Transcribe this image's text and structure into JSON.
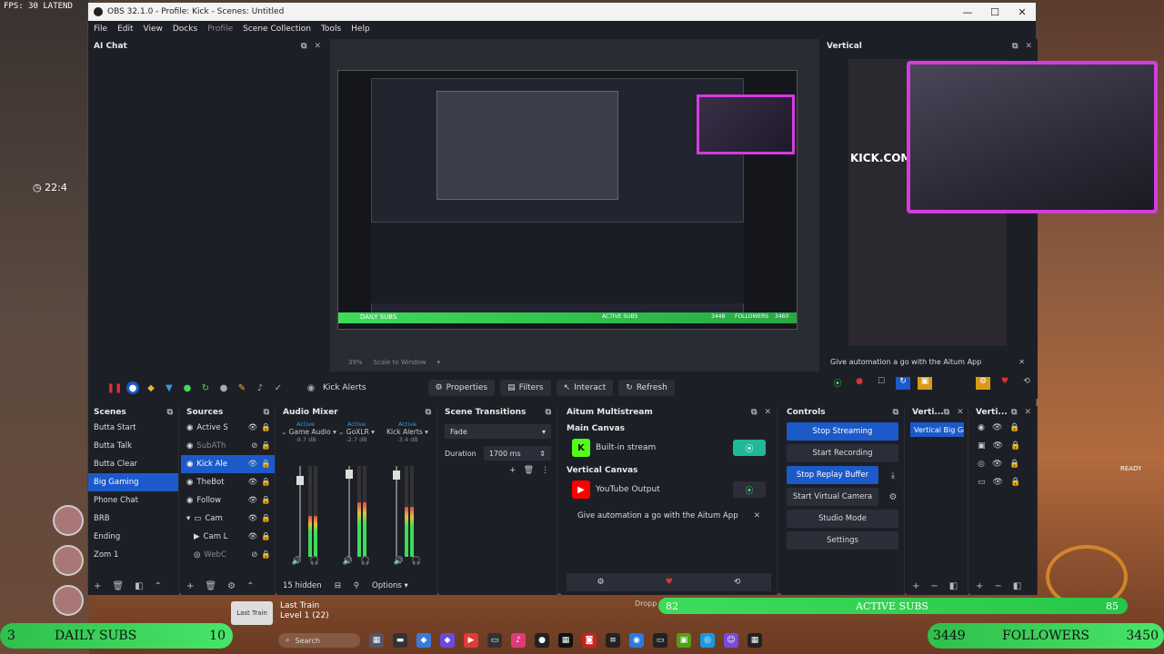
{
  "hud": {
    "fps_label": "FPS:",
    "fps_value": "30",
    "latency_label": "LATEND",
    "clock": "22:4"
  },
  "window": {
    "title": "OBS 32.1.0 - Profile: Kick - Scenes: Untitled",
    "min": "—",
    "max": "☐",
    "close": "✕"
  },
  "menu": [
    "File",
    "Edit",
    "View",
    "Docks",
    "Profile",
    "Scene Collection",
    "Tools",
    "Help"
  ],
  "ai_chat": {
    "title": "AI Chat"
  },
  "preview": {
    "zoom": "39%",
    "scale_mode": "Scale to Window",
    "daily_subs": "DAILY SUBS",
    "followers_small": "FOLLOWERS",
    "followers_left": "3448",
    "followers_right": "3460",
    "active_subs_small": "ACTIVE SUBS"
  },
  "vertical": {
    "title": "Vertical",
    "kick_text": "KICK.COM",
    "notice": "Give automation a go with the Aitum App",
    "notice_close": "✕"
  },
  "toolbar": {
    "source_name": "Kick Alerts",
    "properties": "Properties",
    "filters": "Filters",
    "interact": "Interact",
    "refresh": "Refresh"
  },
  "scenes": {
    "title": "Scenes",
    "items": [
      "Butta Start",
      "Butta Talk",
      "Butta Clear",
      "Big Gaming",
      "Phone Chat",
      "BRB",
      "Ending",
      "Zom 1"
    ],
    "active_index": 3
  },
  "sources": {
    "title": "Sources",
    "items": [
      "Active S",
      "SubATh",
      "Kick Ale",
      "TheBot",
      "Follow",
      "Cam",
      "Cam L",
      "WebC"
    ],
    "active_index": 2
  },
  "audio_mixer": {
    "title": "Audio Mixer",
    "channels": [
      {
        "status": "Active",
        "name": "Game Audio",
        "db": "-9.7 dB",
        "level": 0.45,
        "fader": 0.88
      },
      {
        "status": "Active",
        "name": "GoXLR",
        "db": "-2.7 dB",
        "level": 0.6,
        "fader": 0.96
      },
      {
        "status": "Active",
        "name": "Kick Alerts",
        "db": "-3.4 dB",
        "level": 0.55,
        "fader": 0.94
      }
    ],
    "hidden": "15 hidden",
    "options": "Options"
  },
  "transitions": {
    "title": "Scene Transitions",
    "type": "Fade",
    "duration_label": "Duration",
    "duration_value": "1700 ms"
  },
  "multistream": {
    "title": "Aitum Multistream",
    "main_canvas": "Main Canvas",
    "builtin": "Built-in stream",
    "vertical_canvas": "Vertical Canvas",
    "youtube": "YouTube Output",
    "notice": "Give automation a go with the Aitum App",
    "notice_close": "✕",
    "kick_color": "#53fc18",
    "youtube_color": "#ff0000",
    "toggle_on_color": "#1fb89a"
  },
  "controls": {
    "title": "Controls",
    "stop_streaming": "Stop Streaming",
    "start_recording": "Start Recording",
    "stop_replay": "Stop Replay Buffer",
    "start_virtual": "Start Virtual Camera",
    "studio_mode": "Studio Mode",
    "settings": "Settings"
  },
  "vertical_scenes": {
    "title": "Verti...",
    "item": "Vertical Big Ga"
  },
  "vertical_sources": {
    "title": "Verti..."
  },
  "overlays": {
    "last_train_title": "Last Train",
    "last_train_level": "Level 1 (22)",
    "album_art": "Last Train",
    "dropped": "Dropp",
    "active_subs_left": "82",
    "active_subs_label": "ACTIVE SUBS",
    "active_subs_right": "85",
    "daily_subs_left": "3",
    "daily_subs_label": "DAILY SUBS",
    "daily_subs_right": "10",
    "followers_left": "3449",
    "followers_label": "FOLLOWERS",
    "followers_right": "3450",
    "ready": "READY"
  },
  "taskbar": {
    "search": "Search"
  }
}
